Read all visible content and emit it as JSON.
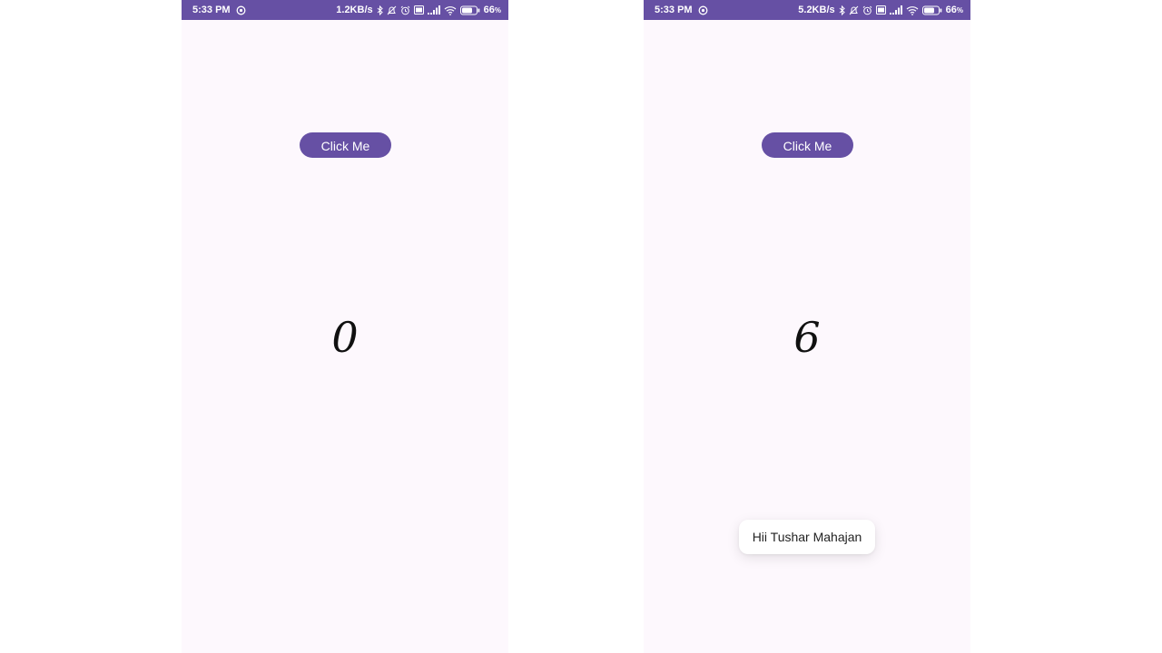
{
  "theme": {
    "accent": "#6650a4",
    "background": "#fdf8fd"
  },
  "screens": [
    {
      "status_bar": {
        "time": "5:33 PM",
        "speed": "1.2KB/s",
        "battery": "66",
        "battery_unit": "%"
      },
      "button_label": "Click Me",
      "counter": "0"
    },
    {
      "status_bar": {
        "time": "5:33 PM",
        "speed": "5.2KB/s",
        "battery": "66",
        "battery_unit": "%"
      },
      "button_label": "Click Me",
      "counter": "6",
      "toast": "Hii Tushar Mahajan"
    }
  ]
}
